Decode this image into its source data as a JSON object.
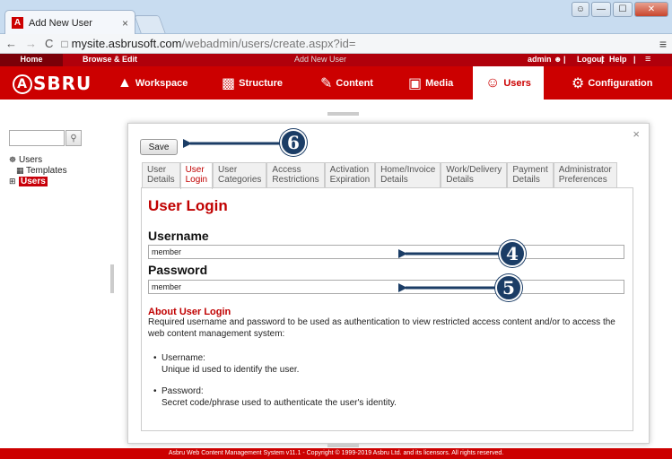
{
  "browser": {
    "tab_title": "Add New User",
    "tab_close": "×",
    "favicon_letter": "A",
    "url_host": "mysite.asbrusoft.com",
    "url_path": "/webadmin/users/create.aspx?id="
  },
  "app_bar": {
    "home": "Home",
    "browse_edit": "Browse & Edit",
    "center_title": "Add New User",
    "user": "admin",
    "logout": "Logout",
    "help": "Help"
  },
  "brand": {
    "a": "A",
    "rest": "SBRU"
  },
  "nav": {
    "items": [
      {
        "label": "Workspace"
      },
      {
        "label": "Structure"
      },
      {
        "label": "Content"
      },
      {
        "label": "Media"
      },
      {
        "label": "Users"
      },
      {
        "label": "Configuration"
      }
    ]
  },
  "tree": {
    "root": "Users",
    "templates": "Templates",
    "selected": "Users"
  },
  "dialog": {
    "close": "×",
    "save_label": "Save",
    "tabs": [
      {
        "l1": "User",
        "l2": "Details"
      },
      {
        "l1": "User",
        "l2": "Login"
      },
      {
        "l1": "User",
        "l2": "Categories"
      },
      {
        "l1": "Access",
        "l2": "Restrictions"
      },
      {
        "l1": "Activation",
        "l2": "Expiration"
      },
      {
        "l1": "Home/Invoice",
        "l2": "Details"
      },
      {
        "l1": "Work/Delivery",
        "l2": "Details"
      },
      {
        "l1": "Payment",
        "l2": "Details"
      },
      {
        "l1": "Administrator",
        "l2": "Preferences"
      }
    ],
    "heading": "User Login",
    "username_label": "Username",
    "username_value": "member",
    "password_label": "Password",
    "password_value": "member",
    "about_heading": "About User Login",
    "about_text": "Required username and password to be used as authentication to view restricted access content and/or to access the web content management system:",
    "bullets": [
      {
        "title": "Username:",
        "desc": "Unique id used to identify the user."
      },
      {
        "title": "Password:",
        "desc": "Secret code/phrase used to authenticate the user's identity."
      }
    ]
  },
  "callouts": {
    "c4": "4",
    "c5": "5",
    "c6": "6"
  },
  "footer": "Asbru Web Content Management System v11.1 - Copyright © 1999-2019 Asbru Ltd. and its licensors. All rights reserved."
}
